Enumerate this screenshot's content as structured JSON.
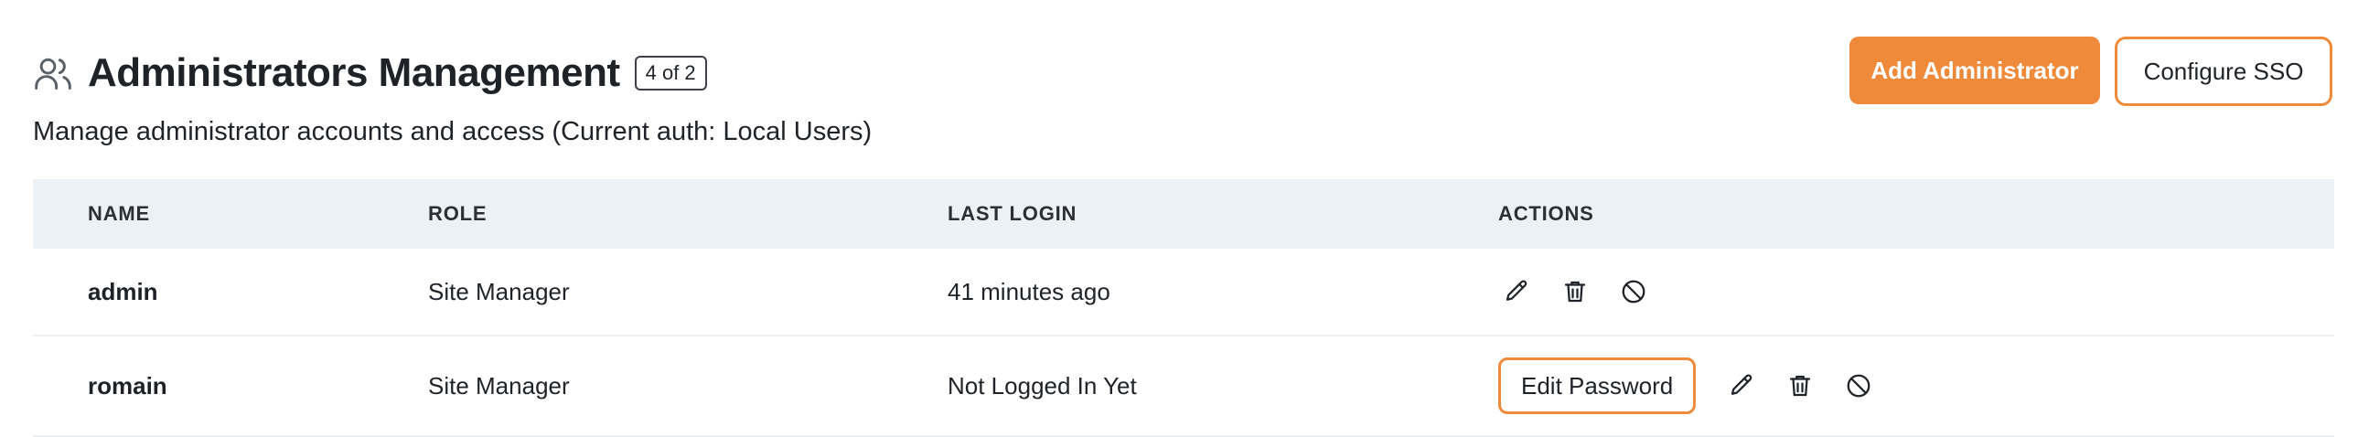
{
  "header": {
    "title": "Administrators Management",
    "count_badge": "4 of 2",
    "icon": "users-icon",
    "subtitle": "Manage administrator accounts and access (Current auth: Local Users)"
  },
  "toolbar": {
    "add_admin_label": "Add Administrator",
    "configure_sso_label": "Configure SSO"
  },
  "table": {
    "columns": [
      "NAME",
      "ROLE",
      "LAST LOGIN",
      "ACTIONS"
    ],
    "rows": [
      {
        "name": "admin",
        "role": "Site Manager",
        "last_login": "41 minutes ago"
      },
      {
        "name": "romain",
        "role": "Site Manager",
        "last_login": "Not Logged In Yet",
        "edit_password_label": "Edit Password"
      }
    ]
  },
  "colors": {
    "accent": "#f08a3b",
    "header_bg": "#ecf1f5",
    "text": "#1f2328"
  }
}
